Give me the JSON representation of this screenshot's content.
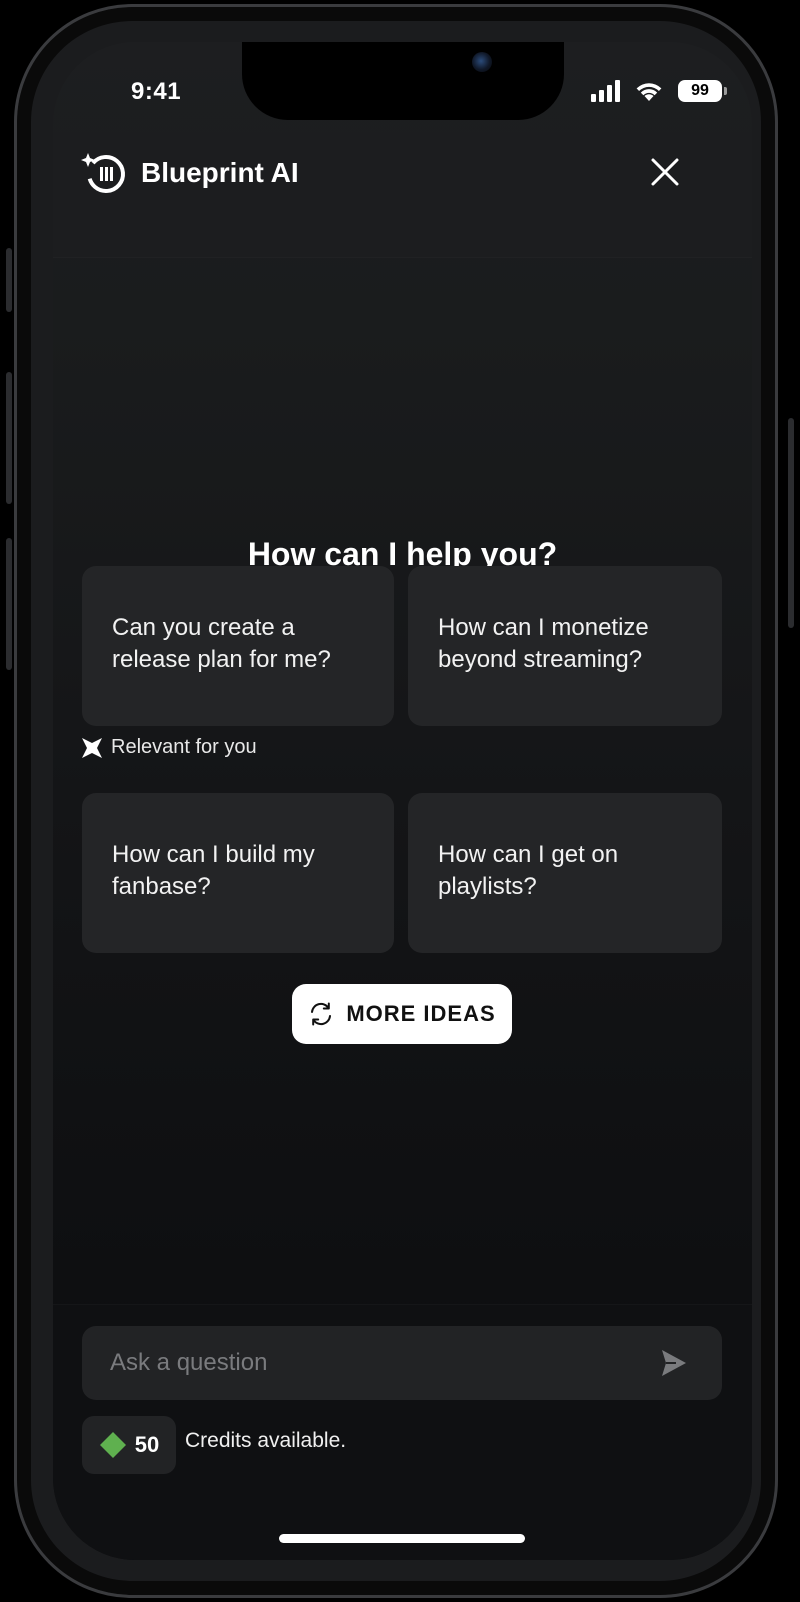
{
  "status_bar": {
    "time": "9:41",
    "battery_level": "99",
    "icons": [
      "cellular-signal-icon",
      "wifi-icon",
      "battery-icon"
    ]
  },
  "header": {
    "title": "Blueprint AI",
    "logo_icon": "blueprint-logo-icon",
    "close_icon": "close-icon"
  },
  "main": {
    "prompt": "How can I help you?",
    "suggestions": [
      {
        "text": "Can you create a release plan for me?"
      },
      {
        "text": "How can I monetize beyond streaming?"
      },
      {
        "text": "How can I build my fanbase?"
      },
      {
        "text": "How can I get on playlists?"
      }
    ],
    "relevant_label": "Relevant for you",
    "relevant_icon": "sparkle-icon",
    "more_ideas_label": "MORE IDEAS",
    "more_ideas_icon": "refresh-icon"
  },
  "composer": {
    "placeholder": "Ask a question",
    "value": "",
    "send_icon": "send-icon"
  },
  "credits": {
    "amount": "50",
    "label": "Credits available.",
    "icon": "credit-diamond-icon",
    "icon_color": "#5fb04f"
  },
  "colors": {
    "background": "#151618",
    "card": "#242527",
    "accent_button": "#ffffff"
  }
}
